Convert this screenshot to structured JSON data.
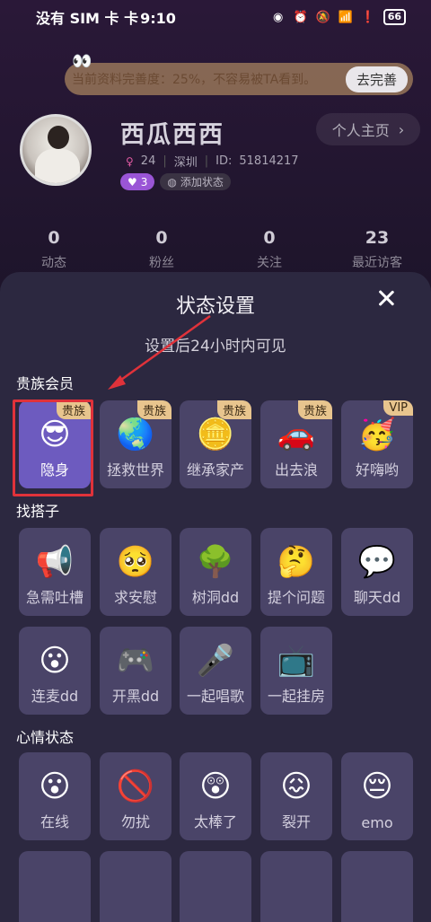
{
  "status_bar": {
    "carrier": "没有 SIM 卡",
    "time": "9:10",
    "battery": "66"
  },
  "completion": {
    "text": "当前资料完善度：25%，不容易被TA看到。",
    "button": "去完善"
  },
  "profile": {
    "name": "西瓜西西",
    "home_button": "个人主页",
    "age": "24",
    "city": "深圳",
    "id_label": "ID:",
    "id_value": "51814217",
    "level": "3",
    "add_status": "添加状态"
  },
  "stats": [
    {
      "num": "0",
      "label": "动态"
    },
    {
      "num": "0",
      "label": "粉丝"
    },
    {
      "num": "0",
      "label": "关注"
    },
    {
      "num": "23",
      "label": "最近访客"
    }
  ],
  "sheet": {
    "title": "状态设置",
    "subtitle": "设置后24小时内可见",
    "sections": [
      {
        "title": "贵族会员",
        "items": [
          {
            "label": "隐身",
            "badge": "贵族",
            "icon": "sunglasses-face-icon",
            "glyph": "😎"
          },
          {
            "label": "拯救世界",
            "badge": "贵族",
            "icon": "globe-icon",
            "glyph": "🌏"
          },
          {
            "label": "继承家产",
            "badge": "贵族",
            "icon": "gold-bars-icon",
            "glyph": "🪙"
          },
          {
            "label": "出去浪",
            "badge": "贵族",
            "icon": "car-icon",
            "glyph": "🚗"
          },
          {
            "label": "好嗨哟",
            "badge": "VIP",
            "icon": "party-face-icon",
            "glyph": "🥳"
          }
        ]
      },
      {
        "title": "找搭子",
        "items": [
          {
            "label": "急需吐槽",
            "icon": "megaphone-icon",
            "glyph": "📢"
          },
          {
            "label": "求安慰",
            "icon": "pleading-face-icon",
            "glyph": "🥺"
          },
          {
            "label": "树洞dd",
            "icon": "tree-hollow-icon",
            "glyph": "🌳"
          },
          {
            "label": "提个问题",
            "icon": "question-face-icon",
            "glyph": "🤔"
          },
          {
            "label": "聊天dd",
            "icon": "chat-bubble-icon",
            "glyph": "💬"
          },
          {
            "label": "连麦dd",
            "icon": "mic-face-icon",
            "glyph": "😮"
          },
          {
            "label": "开黑dd",
            "icon": "game-face-icon",
            "glyph": "🎮"
          },
          {
            "label": "一起唱歌",
            "icon": "microphone-icon",
            "glyph": "🎤"
          },
          {
            "label": "一起挂房",
            "icon": "room-icon",
            "glyph": "📺"
          }
        ]
      },
      {
        "title": "心情状态",
        "items": [
          {
            "label": "在线",
            "icon": "smile-face-icon",
            "glyph": "😮"
          },
          {
            "label": "勿扰",
            "icon": "no-entry-icon",
            "glyph": "🚫"
          },
          {
            "label": "太棒了",
            "icon": "great-face-icon",
            "glyph": "😲"
          },
          {
            "label": "裂开",
            "icon": "cracked-face-icon",
            "glyph": "😖"
          },
          {
            "label": "emo",
            "icon": "sleepy-face-icon",
            "glyph": "😔"
          }
        ]
      }
    ]
  },
  "colors": {
    "sheet_bg": "#2c2840",
    "tile_bg": "#4a4468",
    "selected_tile": "#6d5bbf",
    "badge": "#e8c58e",
    "highlight": "#e0323a"
  }
}
